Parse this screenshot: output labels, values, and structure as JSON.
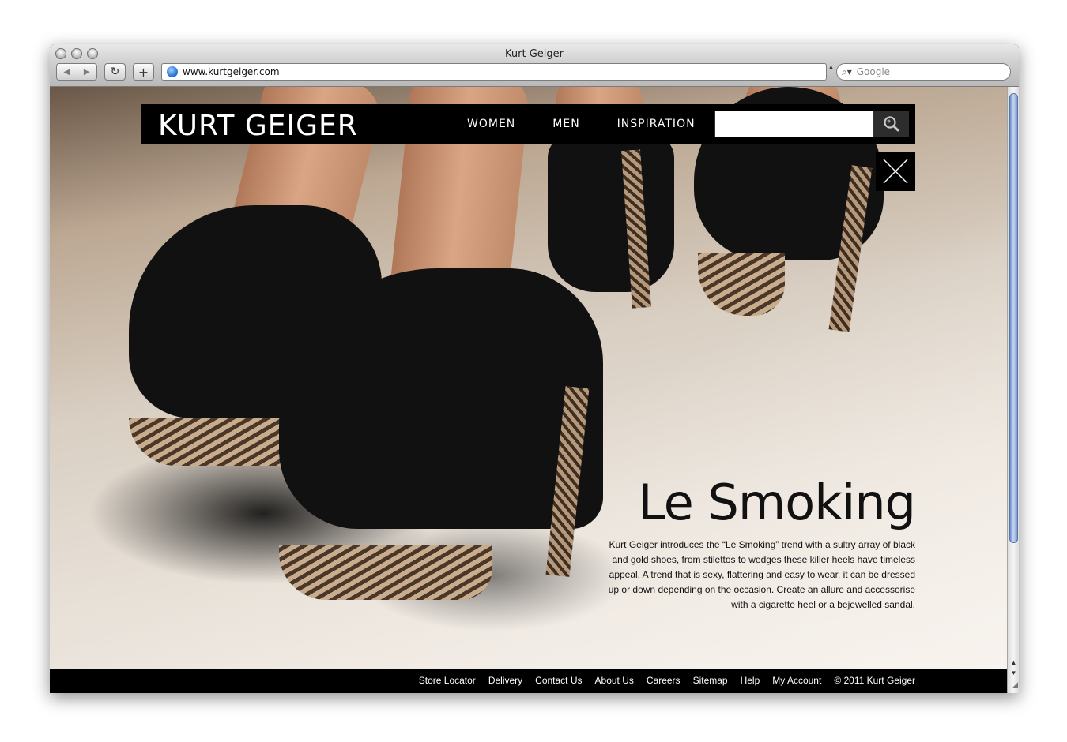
{
  "browser": {
    "window_title": "Kurt Geiger",
    "url": "www.kurtgeiger.com",
    "search_placeholder": "Google",
    "back_glyph": "◀",
    "forward_glyph": "▶",
    "reload_glyph": "↻",
    "newtab_glyph": "+"
  },
  "site": {
    "logo": "KURT GEIGER",
    "nav": [
      "WOMEN",
      "MEN",
      "INSPIRATION"
    ],
    "search_value": "",
    "search_icon": "magnifier-icon",
    "close_icon": "close-x-icon"
  },
  "hero": {
    "headline": "Le Smoking",
    "body": "Kurt Geiger introduces the “Le Smoking” trend with a sultry array of black and gold shoes, from stilettos to wedges these killer heels have timeless appeal. A trend that is sexy, flattering and easy to wear, it can be dressed up or down depending on the occasion. Create an allure and accessorise with a cigarette heel or a bejewelled sandal."
  },
  "footer": {
    "links": [
      "Store Locator",
      "Delivery",
      "Contact Us",
      "About Us",
      "Careers",
      "Sitemap",
      "Help",
      "My Account"
    ],
    "copyright": "© 2011 Kurt Geiger"
  },
  "colors": {
    "header_bg": "#000000",
    "scroll_thumb": "#7b9bd0"
  }
}
